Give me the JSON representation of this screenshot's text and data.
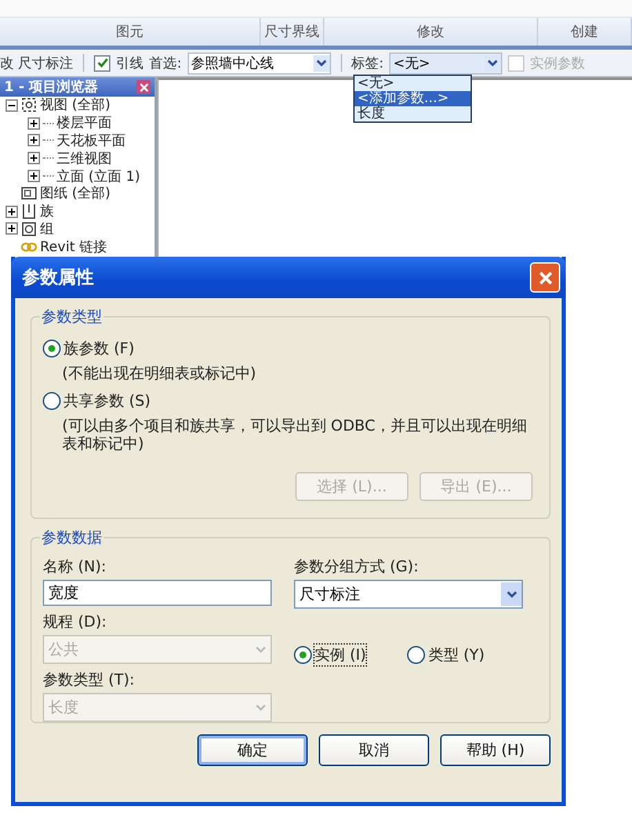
{
  "ribbon": {
    "panels": [
      {
        "label": "图元"
      },
      {
        "label": "尺寸界线"
      },
      {
        "label": "修改"
      },
      {
        "label": "创建"
      }
    ]
  },
  "options_bar": {
    "context": "改 尺寸标注",
    "leader": {
      "label": "引线",
      "checked": true
    },
    "prefer_label": "首选:",
    "prefer_value": "参照墙中心线",
    "tag_label": "标签:",
    "tag_value": "<无>",
    "instance_param": {
      "label": "实例参数",
      "checked": false,
      "disabled": true
    },
    "tag_options": [
      {
        "label": "<无>",
        "selected": false
      },
      {
        "label": "<添加参数...>",
        "selected": true
      },
      {
        "label": "长度",
        "selected": false
      }
    ]
  },
  "project_browser": {
    "title": "1 - 项目浏览器",
    "tree": [
      {
        "label": "视图 (全部)",
        "kind": "view",
        "expanded": true,
        "children": [
          {
            "label": "楼层平面",
            "kind": "plain",
            "expanded": false
          },
          {
            "label": "天花板平面",
            "kind": "plain",
            "expanded": false
          },
          {
            "label": "三维视图",
            "kind": "plain",
            "expanded": false
          },
          {
            "label": "立面 (立面 1)",
            "kind": "plain",
            "expanded": false
          }
        ]
      },
      {
        "label": "图纸 (全部)",
        "kind": "sheet"
      },
      {
        "label": "族",
        "kind": "family",
        "expanded": false
      },
      {
        "label": "组",
        "kind": "group",
        "expanded": false
      },
      {
        "label": "Revit 链接",
        "kind": "link"
      }
    ]
  },
  "dialog": {
    "title": "参数属性",
    "type_group": {
      "legend": "参数类型",
      "options": [
        {
          "label": "族参数 (F)",
          "note": "(不能出现在明细表或标记中)",
          "selected": true
        },
        {
          "label": "共享参数 (S)",
          "note": "(可以由多个项目和族共享，可以导出到 ODBC，并且可以出现在明细表和标记中)",
          "selected": false
        }
      ],
      "buttons": [
        {
          "label": "选择 (L)...",
          "disabled": true
        },
        {
          "label": "导出 (E)...",
          "disabled": true
        }
      ]
    },
    "data_group": {
      "legend": "参数数据",
      "name_label": "名称 (N):",
      "name_value": "宽度",
      "grouping_label": "参数分组方式 (G):",
      "grouping_value": "尺寸标注",
      "discipline_label": "规程 (D):",
      "discipline_value": "公共",
      "discipline_disabled": true,
      "param_type_label": "参数类型 (T):",
      "param_type_value": "长度",
      "param_type_disabled": true,
      "scope": [
        {
          "label": "实例 (I)",
          "selected": true
        },
        {
          "label": "类型 (Y)",
          "selected": false
        }
      ]
    },
    "buttons": [
      {
        "label": "确定",
        "default": true
      },
      {
        "label": "取消",
        "default": false
      },
      {
        "label": "帮助 (H)",
        "default": false
      }
    ]
  }
}
